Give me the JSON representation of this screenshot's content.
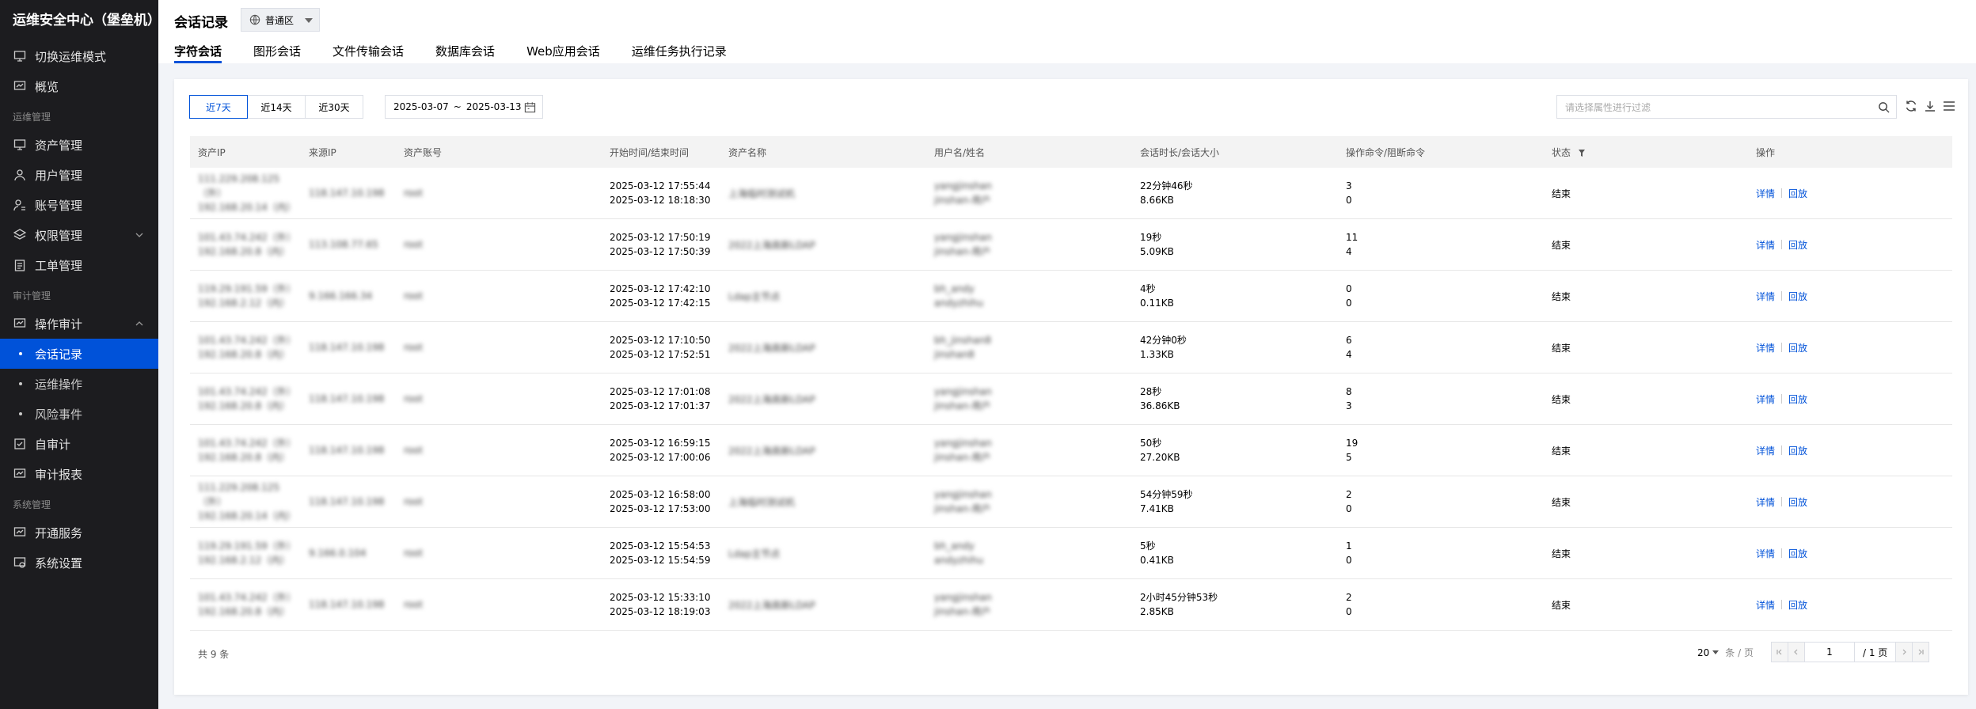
{
  "brand": "运维安全中心（堡垒机）",
  "nav": {
    "switch_mode": "切换运维模式",
    "overview": "概览",
    "group_ops": "运维管理",
    "asset_mgmt": "资产管理",
    "user_mgmt": "用户管理",
    "account_mgmt": "账号管理",
    "perm_mgmt": "权限管理",
    "ticket_mgmt": "工单管理",
    "group_audit": "审计管理",
    "op_audit": "操作审计",
    "session_records": "会话记录",
    "ops_operations": "运维操作",
    "risk_events": "风险事件",
    "self_audit": "自审计",
    "audit_report": "审计报表",
    "group_system": "系统管理",
    "open_service": "开通服务",
    "system_settings": "系统设置"
  },
  "header": {
    "title": "会话记录",
    "region": "普通区",
    "tabs": [
      "字符会话",
      "图形会话",
      "文件传输会话",
      "数据库会话",
      "Web应用会话",
      "运维任务执行记录"
    ]
  },
  "toolbar": {
    "ranges": [
      "近7天",
      "近14天",
      "近30天"
    ],
    "date_start": "2025-03-07",
    "date_sep": "~",
    "date_end": "2025-03-13",
    "filter_placeholder": "请选择属性进行过滤"
  },
  "table": {
    "columns": [
      "资产IP",
      "来源IP",
      "资产账号",
      "开始时间/结束时间",
      "资产名称",
      "用户名/姓名",
      "会话时长/会话大小",
      "操作命令/阻断命令",
      "状态",
      "操作"
    ],
    "rows": [
      {
        "asset_ip": [
          "111.229.208.125（外）",
          "192.168.20.14（内）"
        ],
        "source_ip": "118.147.10.198",
        "account": "root",
        "start": "2025-03-12 17:55:44",
        "end": "2025-03-12 18:18:30",
        "asset_name": "上海临时测试机",
        "user": [
          "yangjinshan",
          "jinshan-用户"
        ],
        "duration": "22分钟46秒",
        "size": "8.66KB",
        "cmds": "3",
        "blocked": "0",
        "status": "结束"
      },
      {
        "asset_ip": [
          "101.43.74.242（外）",
          "192.168.20.8（内）"
        ],
        "source_ip": "113.108.77.65",
        "account": "root",
        "start": "2025-03-12 17:50:19",
        "end": "2025-03-12 17:50:39",
        "asset_name": "2022上海高新LDAP",
        "user": [
          "yangjinshan",
          "jinshan-用户"
        ],
        "duration": "19秒",
        "size": "5.09KB",
        "cmds": "11",
        "blocked": "4",
        "status": "结束"
      },
      {
        "asset_ip": [
          "119.29.191.59（外）",
          "192.168.2.12（内）"
        ],
        "source_ip": "9.166.166.34",
        "account": "root",
        "start": "2025-03-12 17:42:10",
        "end": "2025-03-12 17:42:15",
        "asset_name": "Ldap主节点",
        "user": [
          "bh_andy",
          "andyzhihu"
        ],
        "duration": "4秒",
        "size": "0.11KB",
        "cmds": "0",
        "blocked": "0",
        "status": "结束"
      },
      {
        "asset_ip": [
          "101.43.74.242（外）",
          "192.168.20.8（内）"
        ],
        "source_ip": "118.147.10.198",
        "account": "root",
        "start": "2025-03-12 17:10:50",
        "end": "2025-03-12 17:52:51",
        "asset_name": "2022上海高新LDAP",
        "user": [
          "bh_jinshan8",
          "jinshan8"
        ],
        "duration": "42分钟0秒",
        "size": "1.33KB",
        "cmds": "6",
        "blocked": "4",
        "status": "结束"
      },
      {
        "asset_ip": [
          "101.43.74.242（外）",
          "192.168.20.8（内）"
        ],
        "source_ip": "118.147.10.198",
        "account": "root",
        "start": "2025-03-12 17:01:08",
        "end": "2025-03-12 17:01:37",
        "asset_name": "2022上海高新LDAP",
        "user": [
          "yangjinshan",
          "jinshan-用户"
        ],
        "duration": "28秒",
        "size": "36.86KB",
        "cmds": "8",
        "blocked": "3",
        "status": "结束"
      },
      {
        "asset_ip": [
          "101.43.74.242（外）",
          "192.168.20.8（内）"
        ],
        "source_ip": "118.147.10.198",
        "account": "root",
        "start": "2025-03-12 16:59:15",
        "end": "2025-03-12 17:00:06",
        "asset_name": "2022上海高新LDAP",
        "user": [
          "yangjinshan",
          "jinshan-用户"
        ],
        "duration": "50秒",
        "size": "27.20KB",
        "cmds": "19",
        "blocked": "5",
        "status": "结束"
      },
      {
        "asset_ip": [
          "111.229.208.125（外）",
          "192.168.20.14（内）"
        ],
        "source_ip": "118.147.10.198",
        "account": "root",
        "start": "2025-03-12 16:58:00",
        "end": "2025-03-12 17:53:00",
        "asset_name": "上海临时测试机",
        "user": [
          "yangjinshan",
          "jinshan-用户"
        ],
        "duration": "54分钟59秒",
        "size": "7.41KB",
        "cmds": "2",
        "blocked": "0",
        "status": "结束"
      },
      {
        "asset_ip": [
          "119.29.191.59（外）",
          "192.168.2.12（内）"
        ],
        "source_ip": "9.166.0.104",
        "account": "root",
        "start": "2025-03-12 15:54:53",
        "end": "2025-03-12 15:54:59",
        "asset_name": "Ldap主节点",
        "user": [
          "bh_andy",
          "andyzhihu"
        ],
        "duration": "5秒",
        "size": "0.41KB",
        "cmds": "1",
        "blocked": "0",
        "status": "结束"
      },
      {
        "asset_ip": [
          "101.43.74.242（外）",
          "192.168.20.8（内）"
        ],
        "source_ip": "118.147.10.198",
        "account": "root",
        "start": "2025-03-12 15:33:10",
        "end": "2025-03-12 18:19:03",
        "asset_name": "2022上海高新LDAP",
        "user": [
          "yangjinshan",
          "jinshan-用户"
        ],
        "duration": "2小时45分钟53秒",
        "size": "2.85KB",
        "cmds": "2",
        "blocked": "0",
        "status": "结束"
      }
    ],
    "action_detail": "详情",
    "action_replay": "回放"
  },
  "footer": {
    "total": "共 9 条",
    "page_size": "20",
    "page_size_unit": "条 / 页",
    "current_page": "1",
    "total_pages": "/ 1 页"
  },
  "colors": {
    "accent": "#0052d9",
    "sidebar_bg": "#1c1c1f"
  }
}
